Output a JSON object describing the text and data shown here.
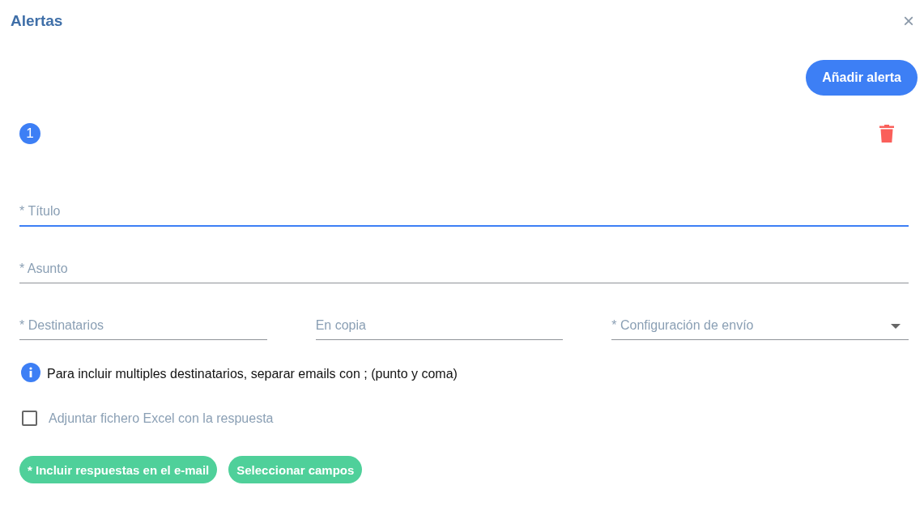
{
  "dialog": {
    "title": "Alertas",
    "close": "×"
  },
  "add_button": "Añadir alerta",
  "alerts": [
    {
      "number": "1",
      "fields": [
        {
          "placeholder": "* Título",
          "focused": true
        },
        {
          "placeholder": "* Asunto",
          "focused": false
        }
      ],
      "row_fields": [
        {
          "kind": "text",
          "placeholder": "* Destinatarios",
          "focused": false
        },
        {
          "kind": "text",
          "placeholder": "En copia",
          "focused": false
        },
        {
          "kind": "select",
          "placeholder": "* Configuración de envío",
          "focused": false
        }
      ],
      "info": "Para incluir multiples destinatarios, separar emails con ; (punto y coma)",
      "checkbox": {
        "label": "Adjuntar fichero Excel con la respuesta",
        "checked": false
      },
      "chips": [
        "* Incluir respuestas en el e-mail",
        "Seleccionar campos"
      ]
    }
  ]
}
